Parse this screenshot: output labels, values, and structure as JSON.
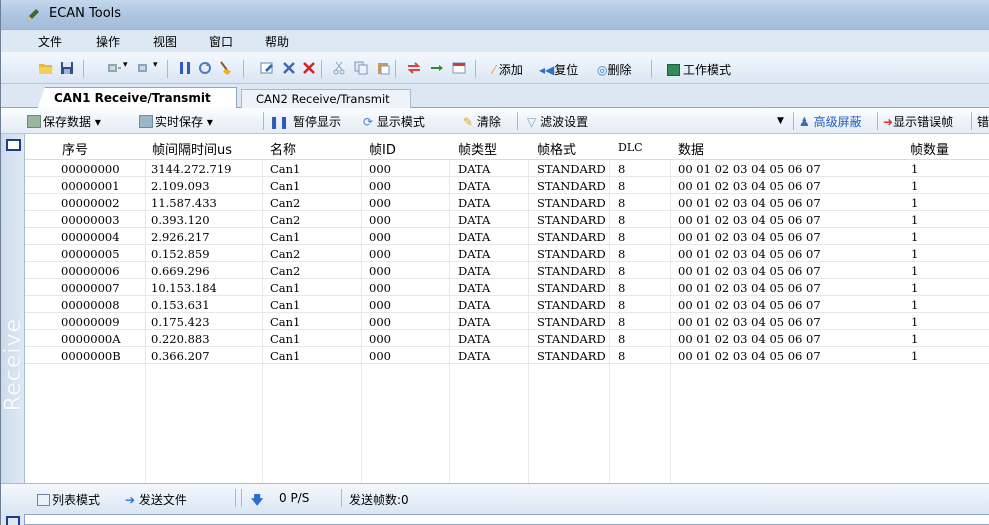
{
  "window": {
    "title": "ECAN Tools"
  },
  "menu": [
    "文件",
    "操作",
    "视图",
    "窗口",
    "帮助"
  ],
  "toolbar": {
    "add_label": "添加",
    "reset_label": "复位",
    "delete_label": "删除",
    "work_mode_label": "工作模式"
  },
  "tabs": [
    "CAN1 Receive/Transmit",
    "CAN2 Receive/Transmit"
  ],
  "subtoolbar": {
    "save_data": "保存数据",
    "realtime_save": "实时保存",
    "pause_display": "暂停显示",
    "display_mode": "显示模式",
    "clear": "清除",
    "filter_settings": "滤波设置",
    "advanced_mask": "高级屏蔽",
    "show_error_frames": "显示错误帧",
    "cut_off_label": "错"
  },
  "sidebar": {
    "vertical_label": "Receive"
  },
  "table": {
    "headers": [
      "序号",
      "帧间隔时间us",
      "名称",
      "帧ID",
      "帧类型",
      "帧格式",
      "DLC",
      "数据",
      "帧数量"
    ],
    "rows": [
      [
        "00000000",
        "3144.272.719",
        "Can1",
        "000",
        "DATA",
        "STANDARD",
        "8",
        "00 01 02 03 04 05 06 07",
        "1"
      ],
      [
        "00000001",
        "2.109.093",
        "Can1",
        "000",
        "DATA",
        "STANDARD",
        "8",
        "00 01 02 03 04 05 06 07",
        "1"
      ],
      [
        "00000002",
        "11.587.433",
        "Can2",
        "000",
        "DATA",
        "STANDARD",
        "8",
        "00 01 02 03 04 05 06 07",
        "1"
      ],
      [
        "00000003",
        "0.393.120",
        "Can2",
        "000",
        "DATA",
        "STANDARD",
        "8",
        "00 01 02 03 04 05 06 07",
        "1"
      ],
      [
        "00000004",
        "2.926.217",
        "Can1",
        "000",
        "DATA",
        "STANDARD",
        "8",
        "00 01 02 03 04 05 06 07",
        "1"
      ],
      [
        "00000005",
        "0.152.859",
        "Can2",
        "000",
        "DATA",
        "STANDARD",
        "8",
        "00 01 02 03 04 05 06 07",
        "1"
      ],
      [
        "00000006",
        "0.669.296",
        "Can2",
        "000",
        "DATA",
        "STANDARD",
        "8",
        "00 01 02 03 04 05 06 07",
        "1"
      ],
      [
        "00000007",
        "10.153.184",
        "Can1",
        "000",
        "DATA",
        "STANDARD",
        "8",
        "00 01 02 03 04 05 06 07",
        "1"
      ],
      [
        "00000008",
        "0.153.631",
        "Can1",
        "000",
        "DATA",
        "STANDARD",
        "8",
        "00 01 02 03 04 05 06 07",
        "1"
      ],
      [
        "00000009",
        "0.175.423",
        "Can1",
        "000",
        "DATA",
        "STANDARD",
        "8",
        "00 01 02 03 04 05 06 07",
        "1"
      ],
      [
        "0000000A",
        "0.220.883",
        "Can1",
        "000",
        "DATA",
        "STANDARD",
        "8",
        "00 01 02 03 04 05 06 07",
        "1"
      ],
      [
        "0000000B",
        "0.366.207",
        "Can1",
        "000",
        "DATA",
        "STANDARD",
        "8",
        "00 01 02 03 04 05 06 07",
        "1"
      ]
    ]
  },
  "statusbar": {
    "list_mode": "列表模式",
    "send_file": "发送文件",
    "rate": "0 P/S",
    "sent_frames": "发送帧数:0"
  }
}
